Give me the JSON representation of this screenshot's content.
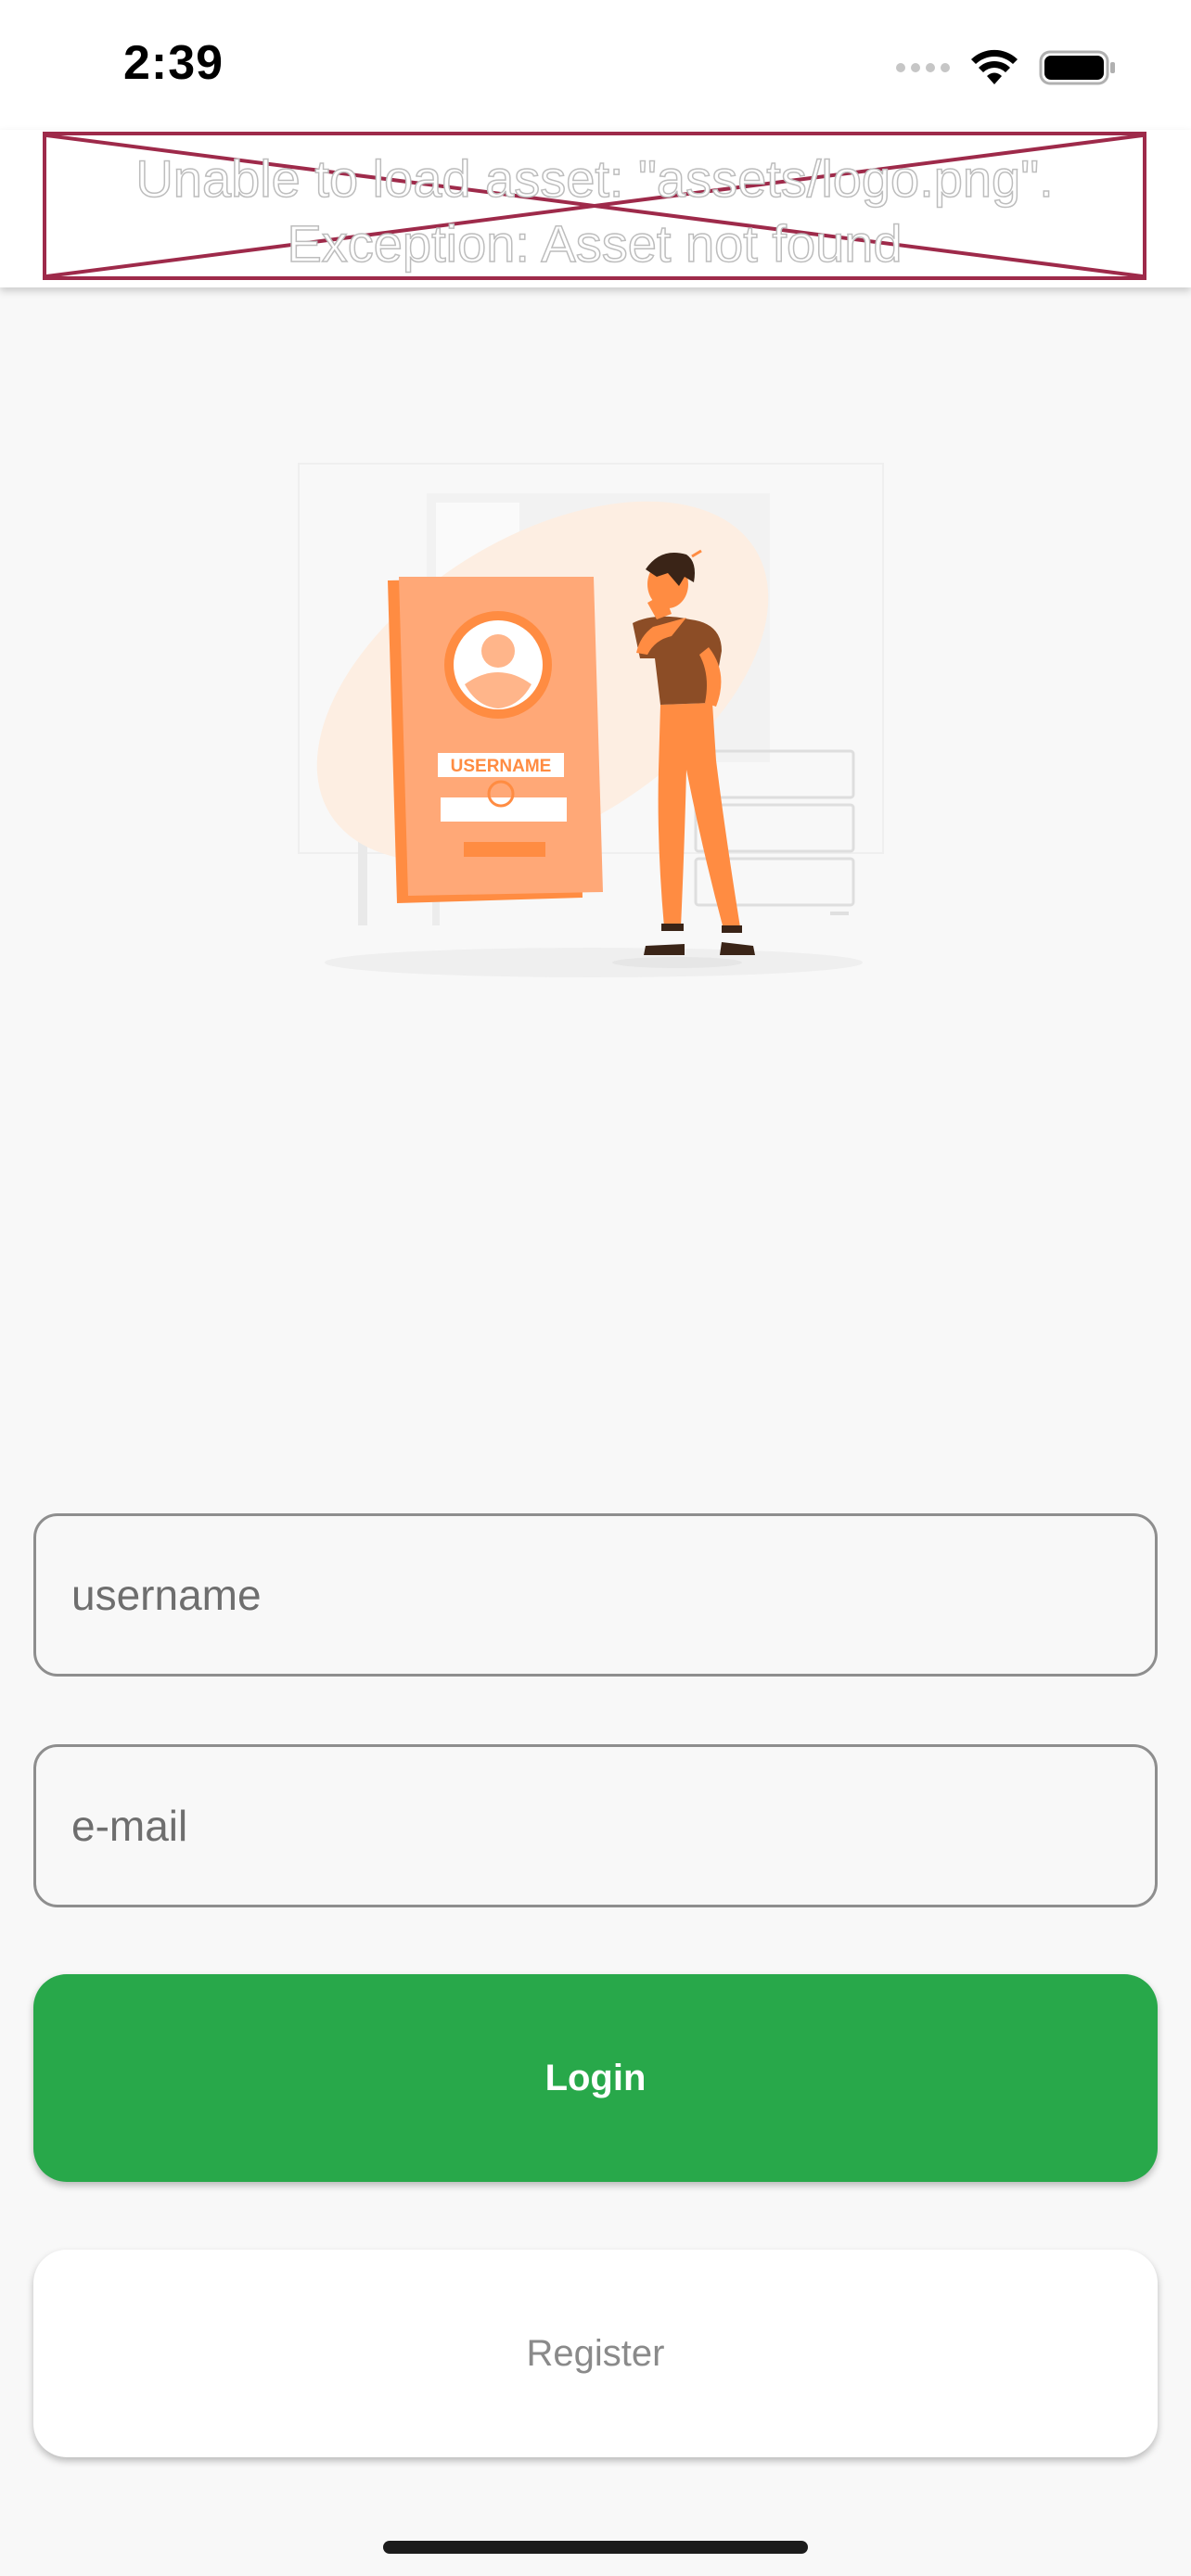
{
  "status_bar": {
    "time": "2:39",
    "icons": [
      "cellular-signal-icon",
      "wifi-icon",
      "battery-icon"
    ]
  },
  "header": {
    "logo_error_text": "Unable to load asset: \"assets/logo.png\".\nException: Asset not found"
  },
  "illustration": {
    "card_label": "USERNAME"
  },
  "form": {
    "username_placeholder": "username",
    "email_placeholder": "e-mail"
  },
  "actions": {
    "login_label": "Login",
    "register_label": "Register"
  },
  "colors": {
    "login_button": "#28a84a",
    "error_border": "#9e2a4a",
    "illustration_orange": "#ff8c42",
    "illustration_brown": "#8c4d26"
  }
}
